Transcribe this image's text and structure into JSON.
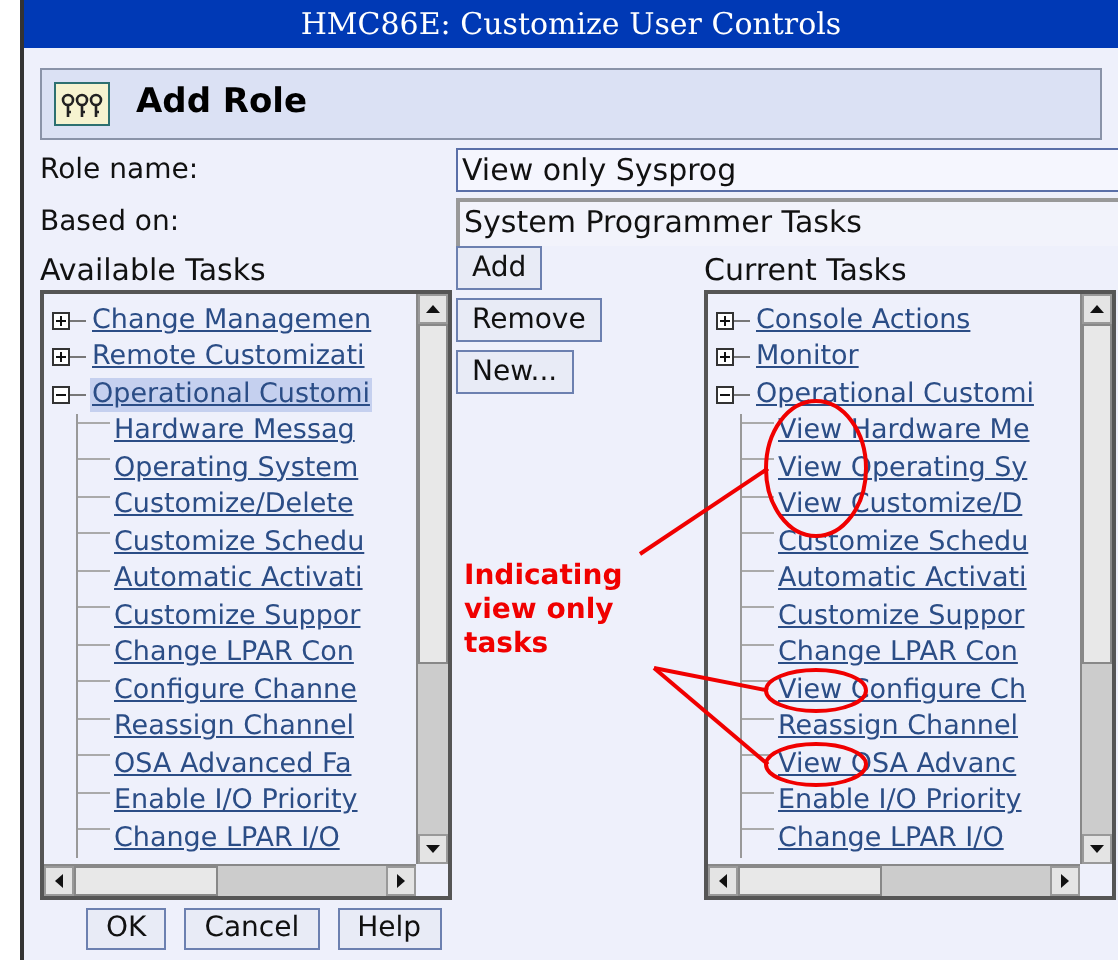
{
  "window": {
    "title": "HMC86E: Customize User Controls"
  },
  "header": {
    "title": "Add Role"
  },
  "form": [
    {
      "label": "Role name:",
      "value": "View only Sysprog",
      "kind": "input"
    },
    {
      "label": "Based on:",
      "value": "System Programmer Tasks",
      "kind": "readonly"
    }
  ],
  "available_tasks": {
    "label": "Available Tasks",
    "items": [
      {
        "label": "Change Managemen",
        "expanded": false,
        "selected": false
      },
      {
        "label": "Remote Customizati",
        "expanded": false,
        "selected": false
      },
      {
        "label": "Operational Customi",
        "expanded": true,
        "selected": true,
        "children": [
          {
            "label": "Hardware Messag"
          },
          {
            "label": "Operating System"
          },
          {
            "label": "Customize/Delete"
          },
          {
            "label": "Customize Schedu"
          },
          {
            "label": "Automatic Activati"
          },
          {
            "label": "Customize Suppor"
          },
          {
            "label": "Change LPAR Con"
          },
          {
            "label": "Configure Channe"
          },
          {
            "label": "Reassign Channel"
          },
          {
            "label": "OSA Advanced Fa"
          },
          {
            "label": "Enable I/O Priority"
          },
          {
            "label": "Change LPAR I/O"
          }
        ]
      }
    ]
  },
  "actions": [
    "Add",
    "Remove",
    "New..."
  ],
  "current_tasks": {
    "label": "Current Tasks",
    "items": [
      {
        "label": "Console Actions",
        "expanded": false,
        "selected": false
      },
      {
        "label": "Monitor",
        "expanded": false,
        "selected": false
      },
      {
        "label": "Operational Customi",
        "expanded": true,
        "selected": false,
        "children": [
          {
            "label": "View Hardware Me",
            "circled": true
          },
          {
            "label": "View Operating Sy",
            "circled": true
          },
          {
            "label": "View Customize/D",
            "circled": true
          },
          {
            "label": "Customize Schedu",
            "circled": false
          },
          {
            "label": "Automatic Activati",
            "circled": false
          },
          {
            "label": "Customize Suppor",
            "circled": false
          },
          {
            "label": "Change LPAR Con",
            "circled": false
          },
          {
            "label": "View Configure Ch",
            "circled": true
          },
          {
            "label": "Reassign Channel",
            "circled": false
          },
          {
            "label": "View OSA Advanc",
            "circled": true
          },
          {
            "label": "Enable I/O Priority",
            "circled": false
          },
          {
            "label": "Change LPAR I/O",
            "circled": false
          }
        ]
      }
    ]
  },
  "annotation": {
    "text": "Indicating view only tasks"
  },
  "buttons": [
    "OK",
    "Cancel",
    "Help"
  ]
}
